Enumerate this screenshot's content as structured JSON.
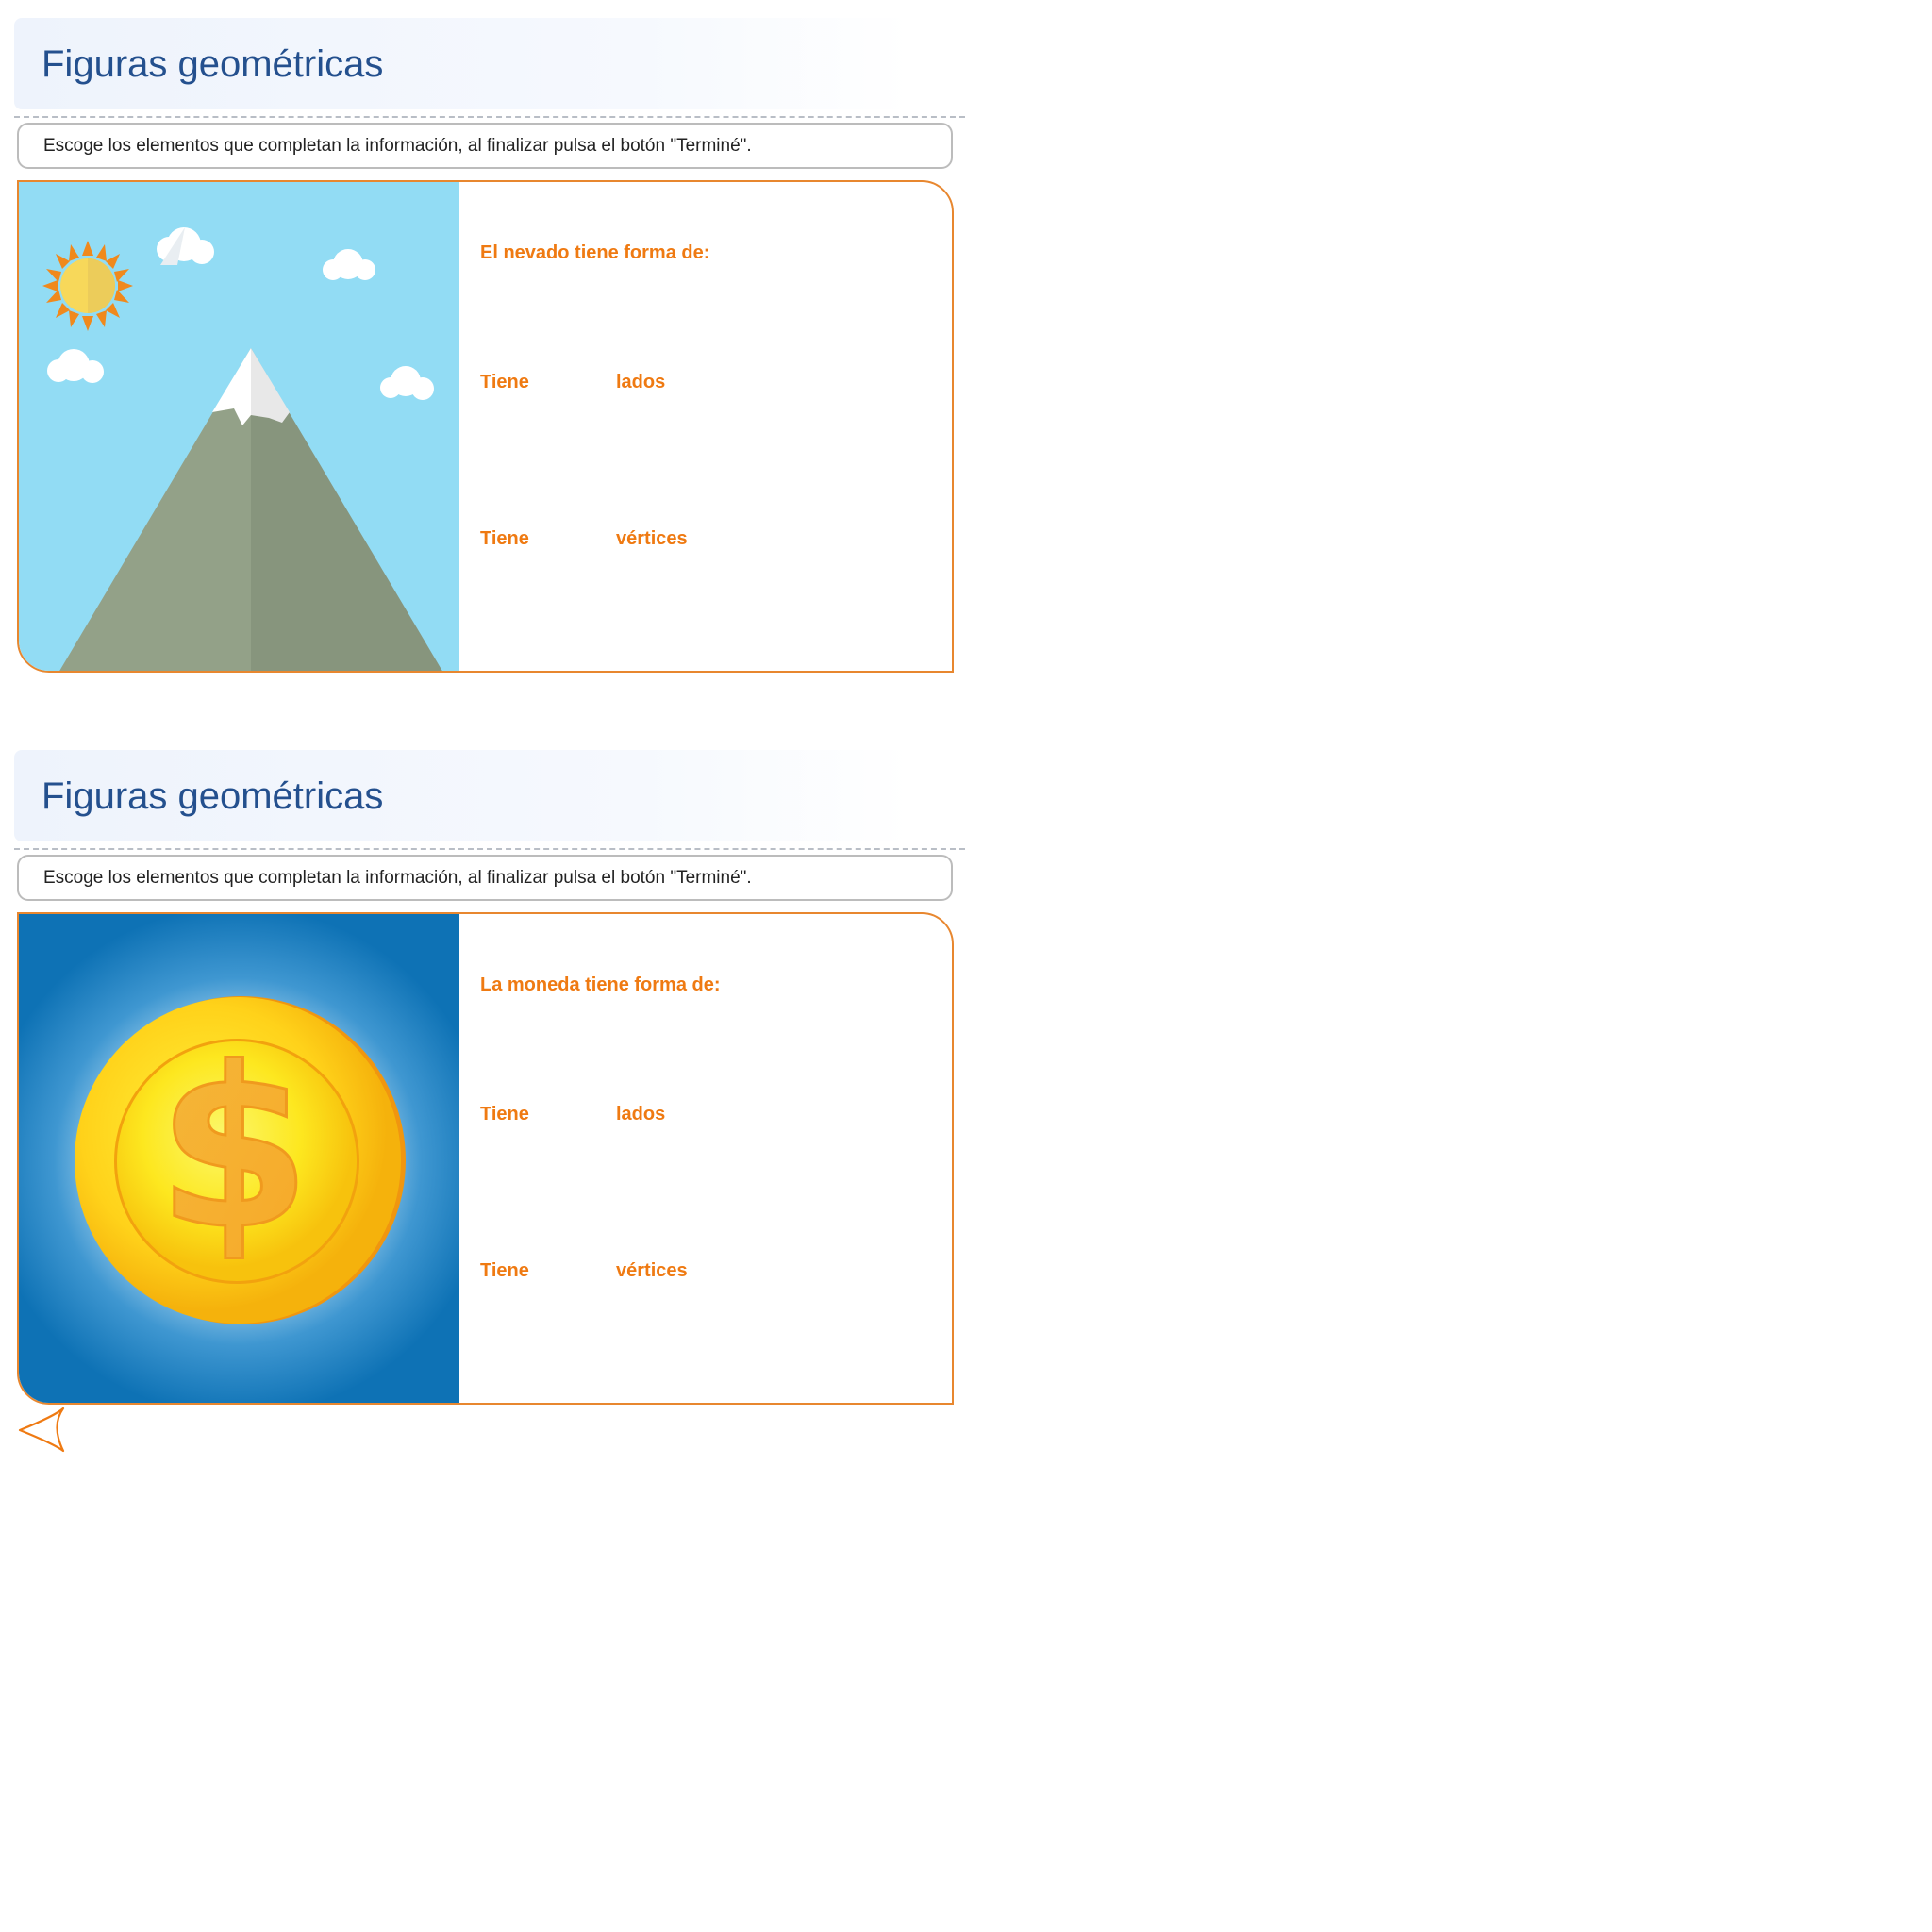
{
  "activities": [
    {
      "title": "Figuras geométricas",
      "instruction": "Escoge los elementos que completan la información, al finalizar pulsa el botón \"Terminé\".",
      "image": "snowy-mountain-illustration",
      "question": "El nevado tiene forma de:",
      "rows": [
        {
          "prefix": "Tiene",
          "suffix": "lados"
        },
        {
          "prefix": "Tiene",
          "suffix": "vértices"
        }
      ]
    },
    {
      "title": "Figuras geométricas",
      "instruction": "Escoge los elementos que completan la información, al finalizar pulsa el botón \"Terminé\".",
      "image": "gold-coin-illustration",
      "question": "La moneda tiene forma de:",
      "rows": [
        {
          "prefix": "Tiene",
          "suffix": "lados"
        },
        {
          "prefix": "Tiene",
          "suffix": "vértices"
        }
      ]
    }
  ],
  "navigation": {
    "back_icon": "back-arrow-icon"
  },
  "colors": {
    "title": "#24508e",
    "accent": "#ef7a12",
    "border": "#e8872f",
    "sky": "#92dcf4",
    "coin_bg": "#0e72b5"
  }
}
